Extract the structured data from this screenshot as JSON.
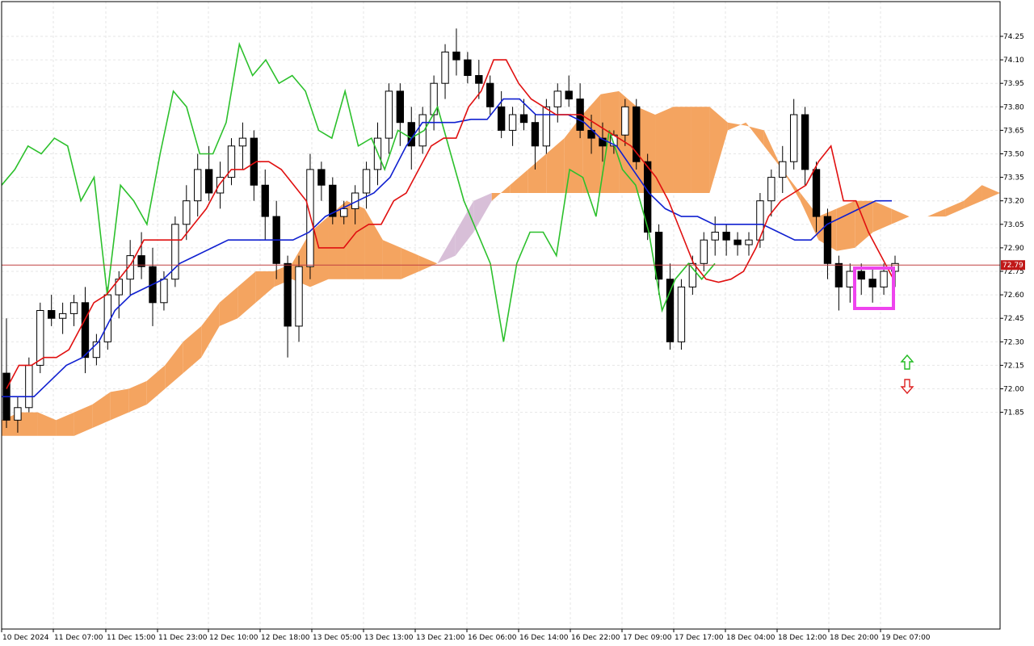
{
  "chart_data": {
    "type": "candlestick",
    "title": "",
    "xlabel": "",
    "ylabel": "",
    "ylim": [
      71.7,
      74.35
    ],
    "y_ticks": [
      "74.25",
      "74.10",
      "73.95",
      "73.80",
      "73.65",
      "73.50",
      "73.35",
      "73.20",
      "73.05",
      "72.90",
      "72.75",
      "72.60",
      "72.45",
      "72.30",
      "72.15",
      "72.00",
      "71.85"
    ],
    "x_ticks": [
      "10 Dec 2024",
      "11 Dec 07:00",
      "11 Dec 15:00",
      "11 Dec 23:00",
      "12 Dec 10:00",
      "12 Dec 18:00",
      "13 Dec 05:00",
      "13 Dec 13:00",
      "13 Dec 21:00",
      "16 Dec 06:00",
      "16 Dec 14:00",
      "16 Dec 22:00",
      "17 Dec 09:00",
      "17 Dec 17:00",
      "18 Dec 04:00",
      "18 Dec 12:00",
      "18 Dec 20:00",
      "19 Dec 07:00"
    ],
    "grid": true,
    "current_price": "72.79",
    "colors": {
      "background": "#ffffff",
      "grid": "#e6e6e6",
      "axis": "#000000",
      "tenkan": "#e01010",
      "kijun": "#1020d0",
      "chikou": "#2cc02c",
      "cloud_bull": "#f4a460",
      "cloud_bear": "#d8bfd8",
      "price_line": "#c04040",
      "price_tag": "#c01818",
      "highlight_box": "#ee44ee",
      "arrow_up": "#22bb22",
      "arrow_down": "#dd2222"
    },
    "candles": [
      [
        72.1,
        72.45,
        71.75,
        71.8
      ],
      [
        71.8,
        71.95,
        71.72,
        71.88
      ],
      [
        71.88,
        72.2,
        71.85,
        72.15
      ],
      [
        72.15,
        72.55,
        72.1,
        72.5
      ],
      [
        72.5,
        72.6,
        72.4,
        72.45
      ],
      [
        72.45,
        72.55,
        72.35,
        72.48
      ],
      [
        72.48,
        72.6,
        72.4,
        72.55
      ],
      [
        72.55,
        72.65,
        72.1,
        72.2
      ],
      [
        72.2,
        72.35,
        72.15,
        72.3
      ],
      [
        72.3,
        72.65,
        72.25,
        72.6
      ],
      [
        72.6,
        72.75,
        72.45,
        72.7
      ],
      [
        72.7,
        72.95,
        72.6,
        72.85
      ],
      [
        72.85,
        73.0,
        72.7,
        72.78
      ],
      [
        72.78,
        72.9,
        72.4,
        72.55
      ],
      [
        72.55,
        72.75,
        72.5,
        72.7
      ],
      [
        72.7,
        73.1,
        72.65,
        73.05
      ],
      [
        73.05,
        73.3,
        72.95,
        73.2
      ],
      [
        73.2,
        73.5,
        73.1,
        73.4
      ],
      [
        73.4,
        73.55,
        73.2,
        73.25
      ],
      [
        73.25,
        73.45,
        73.15,
        73.35
      ],
      [
        73.35,
        73.6,
        73.3,
        73.55
      ],
      [
        73.55,
        73.7,
        73.4,
        73.6
      ],
      [
        73.6,
        73.65,
        73.2,
        73.3
      ],
      [
        73.3,
        73.4,
        72.95,
        73.1
      ],
      [
        73.1,
        73.2,
        72.7,
        72.8
      ],
      [
        72.8,
        72.85,
        72.2,
        72.4
      ],
      [
        72.4,
        72.85,
        72.3,
        72.78
      ],
      [
        72.78,
        73.5,
        72.7,
        73.4
      ],
      [
        73.4,
        73.45,
        73.2,
        73.3
      ],
      [
        73.3,
        73.35,
        73.05,
        73.1
      ],
      [
        73.1,
        73.2,
        73.05,
        73.15
      ],
      [
        73.15,
        73.3,
        73.05,
        73.25
      ],
      [
        73.25,
        73.45,
        73.15,
        73.4
      ],
      [
        73.4,
        73.7,
        73.3,
        73.6
      ],
      [
        73.6,
        73.95,
        73.5,
        73.9
      ],
      [
        73.9,
        73.95,
        73.55,
        73.7
      ],
      [
        73.7,
        73.8,
        73.4,
        73.55
      ],
      [
        73.55,
        73.8,
        73.5,
        73.75
      ],
      [
        73.75,
        74.0,
        73.65,
        73.95
      ],
      [
        73.95,
        74.2,
        73.85,
        74.15
      ],
      [
        74.15,
        74.3,
        74.0,
        74.1
      ],
      [
        74.1,
        74.15,
        73.95,
        74.0
      ],
      [
        74.0,
        74.1,
        73.85,
        73.95
      ],
      [
        73.95,
        74.0,
        73.75,
        73.8
      ],
      [
        73.8,
        73.9,
        73.6,
        73.65
      ],
      [
        73.65,
        73.8,
        73.55,
        73.75
      ],
      [
        73.75,
        73.85,
        73.65,
        73.7
      ],
      [
        73.7,
        73.75,
        73.4,
        73.55
      ],
      [
        73.55,
        73.85,
        73.5,
        73.8
      ],
      [
        73.8,
        73.95,
        73.7,
        73.9
      ],
      [
        73.9,
        74.0,
        73.8,
        73.85
      ],
      [
        73.85,
        73.95,
        73.6,
        73.65
      ],
      [
        73.65,
        73.75,
        73.5,
        73.6
      ],
      [
        73.6,
        73.7,
        73.45,
        73.55
      ],
      [
        73.55,
        73.65,
        73.5,
        73.62
      ],
      [
        73.62,
        73.85,
        73.55,
        73.8
      ],
      [
        73.8,
        73.85,
        73.4,
        73.45
      ],
      [
        73.45,
        73.5,
        72.95,
        73.0
      ],
      [
        73.0,
        73.05,
        72.6,
        72.7
      ],
      [
        72.7,
        72.8,
        72.25,
        72.3
      ],
      [
        72.3,
        72.7,
        72.25,
        72.65
      ],
      [
        72.65,
        72.85,
        72.6,
        72.8
      ],
      [
        72.8,
        73.0,
        72.75,
        72.95
      ],
      [
        72.95,
        73.1,
        72.85,
        73.0
      ],
      [
        73.0,
        73.05,
        72.85,
        72.95
      ],
      [
        72.95,
        73.0,
        72.85,
        72.92
      ],
      [
        72.92,
        73.0,
        72.85,
        72.95
      ],
      [
        72.95,
        73.25,
        72.9,
        73.2
      ],
      [
        73.2,
        73.4,
        73.1,
        73.35
      ],
      [
        73.35,
        73.55,
        73.25,
        73.45
      ],
      [
        73.45,
        73.85,
        73.4,
        73.75
      ],
      [
        73.75,
        73.8,
        73.3,
        73.4
      ],
      [
        73.4,
        73.45,
        73.0,
        73.1
      ],
      [
        73.1,
        73.15,
        72.7,
        72.8
      ],
      [
        72.8,
        72.85,
        72.5,
        72.65
      ],
      [
        72.65,
        72.8,
        72.55,
        72.75
      ],
      [
        72.75,
        72.8,
        72.6,
        72.7
      ],
      [
        72.7,
        72.78,
        72.55,
        72.65
      ],
      [
        72.65,
        72.8,
        72.6,
        72.75
      ],
      [
        72.75,
        72.85,
        72.65,
        72.8
      ]
    ],
    "series": [
      {
        "name": "",
        "role": "tenkan",
        "values": [
          72.0,
          72.15,
          72.15,
          72.2,
          72.2,
          72.25,
          72.4,
          72.55,
          72.6,
          72.7,
          72.8,
          72.95,
          72.95,
          72.95,
          72.95,
          73.05,
          73.15,
          73.3,
          73.4,
          73.4,
          73.45,
          73.45,
          73.4,
          73.3,
          73.2,
          72.9,
          72.9,
          72.9,
          73.0,
          73.05,
          73.05,
          73.2,
          73.25,
          73.4,
          73.55,
          73.6,
          73.6,
          73.8,
          73.9,
          74.1,
          74.1,
          73.95,
          73.85,
          73.8,
          73.75,
          73.75,
          73.75,
          73.7,
          73.65,
          73.6,
          73.55,
          73.45,
          73.35,
          73.2,
          73.0,
          72.8,
          72.7,
          72.68,
          72.7,
          72.75,
          72.9,
          73.1,
          73.2,
          73.25,
          73.3,
          73.45,
          73.55,
          73.2,
          73.2,
          73.0,
          72.85,
          72.7
        ]
      },
      {
        "name": "",
        "role": "kijun",
        "values": [
          71.95,
          71.95,
          71.95,
          72.05,
          72.15,
          72.2,
          72.3,
          72.5,
          72.6,
          72.65,
          72.7,
          72.8,
          72.85,
          72.9,
          72.95,
          72.95,
          72.95,
          72.95,
          72.95,
          73.0,
          73.1,
          73.15,
          73.2,
          73.25,
          73.35,
          73.55,
          73.7,
          73.7,
          73.7,
          73.72,
          73.72,
          73.85,
          73.85,
          73.75,
          73.75,
          73.75,
          73.7,
          73.6,
          73.55,
          73.4,
          73.25,
          73.15,
          73.1,
          73.1,
          73.05,
          73.05,
          73.05,
          73.05,
          73.0,
          72.95,
          72.95,
          73.05,
          73.1,
          73.15,
          73.2,
          73.2
        ]
      },
      {
        "name": "",
        "role": "chikou",
        "values": [
          73.3,
          73.4,
          73.55,
          73.5,
          73.6,
          73.55,
          73.2,
          73.35,
          72.6,
          73.3,
          73.2,
          73.05,
          73.5,
          73.9,
          73.8,
          73.5,
          73.5,
          73.7,
          74.2,
          74.0,
          74.1,
          73.95,
          74.0,
          73.9,
          73.65,
          73.6,
          73.9,
          73.55,
          73.6,
          73.4,
          73.65,
          73.6,
          73.65,
          73.8,
          73.5,
          73.2,
          73.0,
          72.8,
          72.3,
          72.8,
          73.0,
          73.0,
          72.85,
          73.4,
          73.35,
          73.1,
          73.65,
          73.4,
          73.3,
          73.0,
          72.5,
          72.7,
          72.8,
          72.7,
          72.8
        ]
      },
      {
        "name": "",
        "role": "span_a",
        "values": [
          71.8,
          71.85,
          71.85,
          71.8,
          71.85,
          71.9,
          71.98,
          72.0,
          72.05,
          72.15,
          72.3,
          72.4,
          72.55,
          72.65,
          72.75,
          72.75,
          72.8,
          73.0,
          73.1,
          73.2,
          73.15,
          72.95,
          72.9,
          72.85,
          72.8,
          72.85,
          73.0,
          73.2,
          73.3,
          73.4,
          73.5,
          73.6,
          73.75,
          73.88,
          73.9,
          73.8,
          73.75,
          73.8,
          73.8,
          73.8,
          73.7,
          73.68,
          73.65,
          73.4,
          73.25,
          73.1,
          73.15,
          73.2,
          73.2,
          73.15,
          73.1,
          73.1,
          73.15,
          73.2,
          73.3,
          73.25
        ]
      },
      {
        "name": "",
        "role": "span_b",
        "values": [
          71.7,
          71.7,
          71.7,
          71.7,
          71.7,
          71.75,
          71.8,
          71.85,
          71.9,
          72.0,
          72.1,
          72.2,
          72.4,
          72.45,
          72.55,
          72.65,
          72.7,
          72.65,
          72.7,
          72.7,
          72.7,
          72.7,
          72.7,
          72.75,
          72.8,
          73.0,
          73.2,
          73.25,
          73.25,
          73.25,
          73.25,
          73.25,
          73.25,
          73.25,
          73.25,
          73.25,
          73.25,
          73.25,
          73.25,
          73.25,
          73.65,
          73.7,
          73.55,
          73.4,
          73.2,
          72.95,
          72.88,
          72.9,
          73.0,
          73.05,
          73.1,
          73.1,
          73.1,
          73.15,
          73.2,
          73.25
        ]
      }
    ]
  }
}
